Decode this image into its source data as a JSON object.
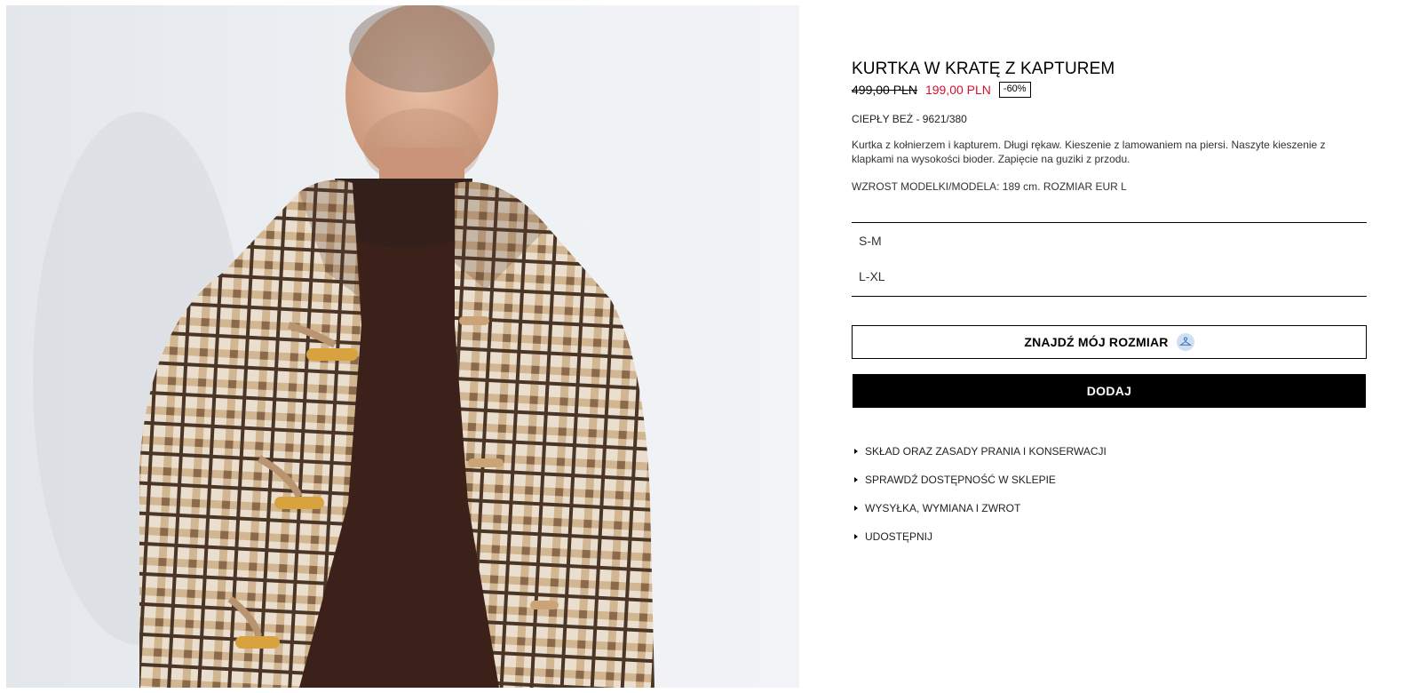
{
  "product": {
    "title": "KURTKA W KRATĘ Z KAPTUREM",
    "price_old": "499,00 PLN",
    "price_new": "199,00 PLN",
    "discount": "-60%",
    "color_ref": "CIEPŁY BEŻ - 9621/380",
    "description": "Kurtka z kołnierzem i kapturem. Długi rękaw. Kieszenie z lamowaniem na piersi. Naszyte kieszenie z klapkami na wysokości bioder. Zapięcie na guziki z przodu.",
    "model_info": "WZROST MODELKI/MODELA: 189 cm. ROZMIAR EUR L"
  },
  "sizes": [
    "S-M",
    "L-XL"
  ],
  "buttons": {
    "find_size": "ZNAJDŹ MÓJ ROZMIAR",
    "find_size_icon": "hanger-icon",
    "add": "DODAJ"
  },
  "info_links": [
    "SKŁAD ORAZ ZASADY PRANIA I KONSERWACJI",
    "SPRAWDŹ DOSTĘPNOŚĆ W SKLEPIE",
    "WYSYŁKA, WYMIANA I ZWROT",
    "UDOSTĘPNIJ"
  ],
  "colors": {
    "sale_price": "#d8112a",
    "primary_button": "#000000",
    "icon_bg": "#cfe0f3"
  }
}
